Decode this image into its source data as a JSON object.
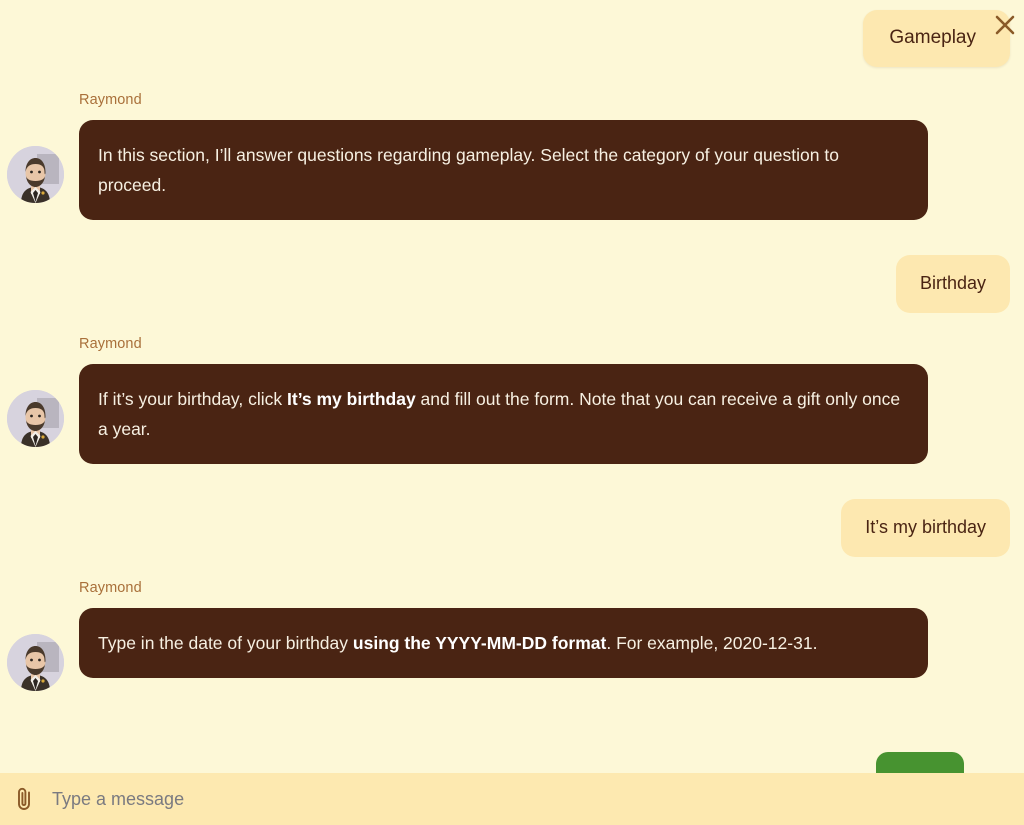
{
  "header": {
    "section_label": "Gameplay",
    "close_icon": "close-icon",
    "chip_bg": "#fde8b0",
    "text_color": "#4a2413"
  },
  "theme": {
    "page_bg": "#fdf8d7",
    "bot_bubble_bg": "#4a2413",
    "bot_bubble_text": "#f7f0e2",
    "user_bubble_bg": "#fde8b0",
    "user_bubble_text": "#4a2413",
    "sender_name_color": "#a9703a",
    "composer_bg": "#fde9b0",
    "green_button": "#479330"
  },
  "messages": [
    {
      "role": "bot",
      "sender": "Raymond",
      "avatar": "raymond-avatar",
      "segments": [
        {
          "text": "In this section, I’ll answer questions regarding gameplay. Select the category of your question to proceed.",
          "bold": false
        }
      ]
    },
    {
      "role": "user",
      "text": "Birthday"
    },
    {
      "role": "bot",
      "sender": "Raymond",
      "avatar": "raymond-avatar",
      "segments": [
        {
          "text": "If it’s your birthday, click ",
          "bold": false
        },
        {
          "text": "It’s my birthday",
          "bold": true
        },
        {
          "text": " and fill out the form. Note that you can receive a gift only once a year.",
          "bold": false
        }
      ]
    },
    {
      "role": "user",
      "text": "It’s my birthday"
    },
    {
      "role": "bot",
      "sender": "Raymond",
      "avatar": "raymond-avatar",
      "segments": [
        {
          "text": "Type in the date of your birthday ",
          "bold": false
        },
        {
          "text": "using the YYYY-MM-DD format",
          "bold": true
        },
        {
          "text": ". For example, 2020-12-31.",
          "bold": false
        }
      ]
    },
    {
      "role": "user-partial",
      "text": ""
    }
  ],
  "composer": {
    "attach_icon": "paperclip-icon",
    "placeholder": "Type a message",
    "value": ""
  }
}
